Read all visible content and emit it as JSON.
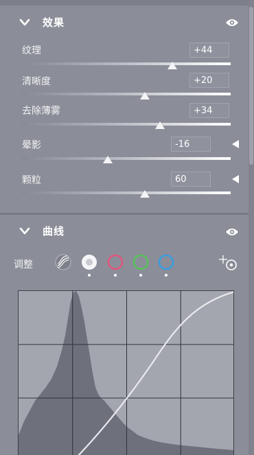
{
  "effects": {
    "title": "效果",
    "sliders": [
      {
        "label": "纹理",
        "value": "+44",
        "level": 0.72
      },
      {
        "label": "清晰度",
        "value": "+20",
        "level": 0.59
      },
      {
        "label": "去除薄雾",
        "value": "+34",
        "level": 0.66
      },
      {
        "label": "晕影",
        "value": "-16",
        "level": 0.41
      },
      {
        "label": "颗粒",
        "value": "60",
        "level": 0.59
      }
    ]
  },
  "curve": {
    "title": "曲线",
    "adjust_label": "调整",
    "channels": [
      {
        "name": "parametric",
        "color": "#ffffff"
      },
      {
        "name": "rgb",
        "color": "#ffffff"
      },
      {
        "name": "red",
        "color": "#e0577f"
      },
      {
        "name": "green",
        "color": "#58c15b"
      },
      {
        "name": "blue",
        "color": "#3a9be0"
      }
    ],
    "selected_channel": "rgb",
    "grid_divisions": 4
  },
  "colors": {
    "panel_bg": "#8b8e98",
    "accent_white": "#ffffff"
  },
  "icons": [
    "chevron-down-icon",
    "eye-icon",
    "parametric-curve-icon",
    "targeted-adjustment-icon"
  ]
}
